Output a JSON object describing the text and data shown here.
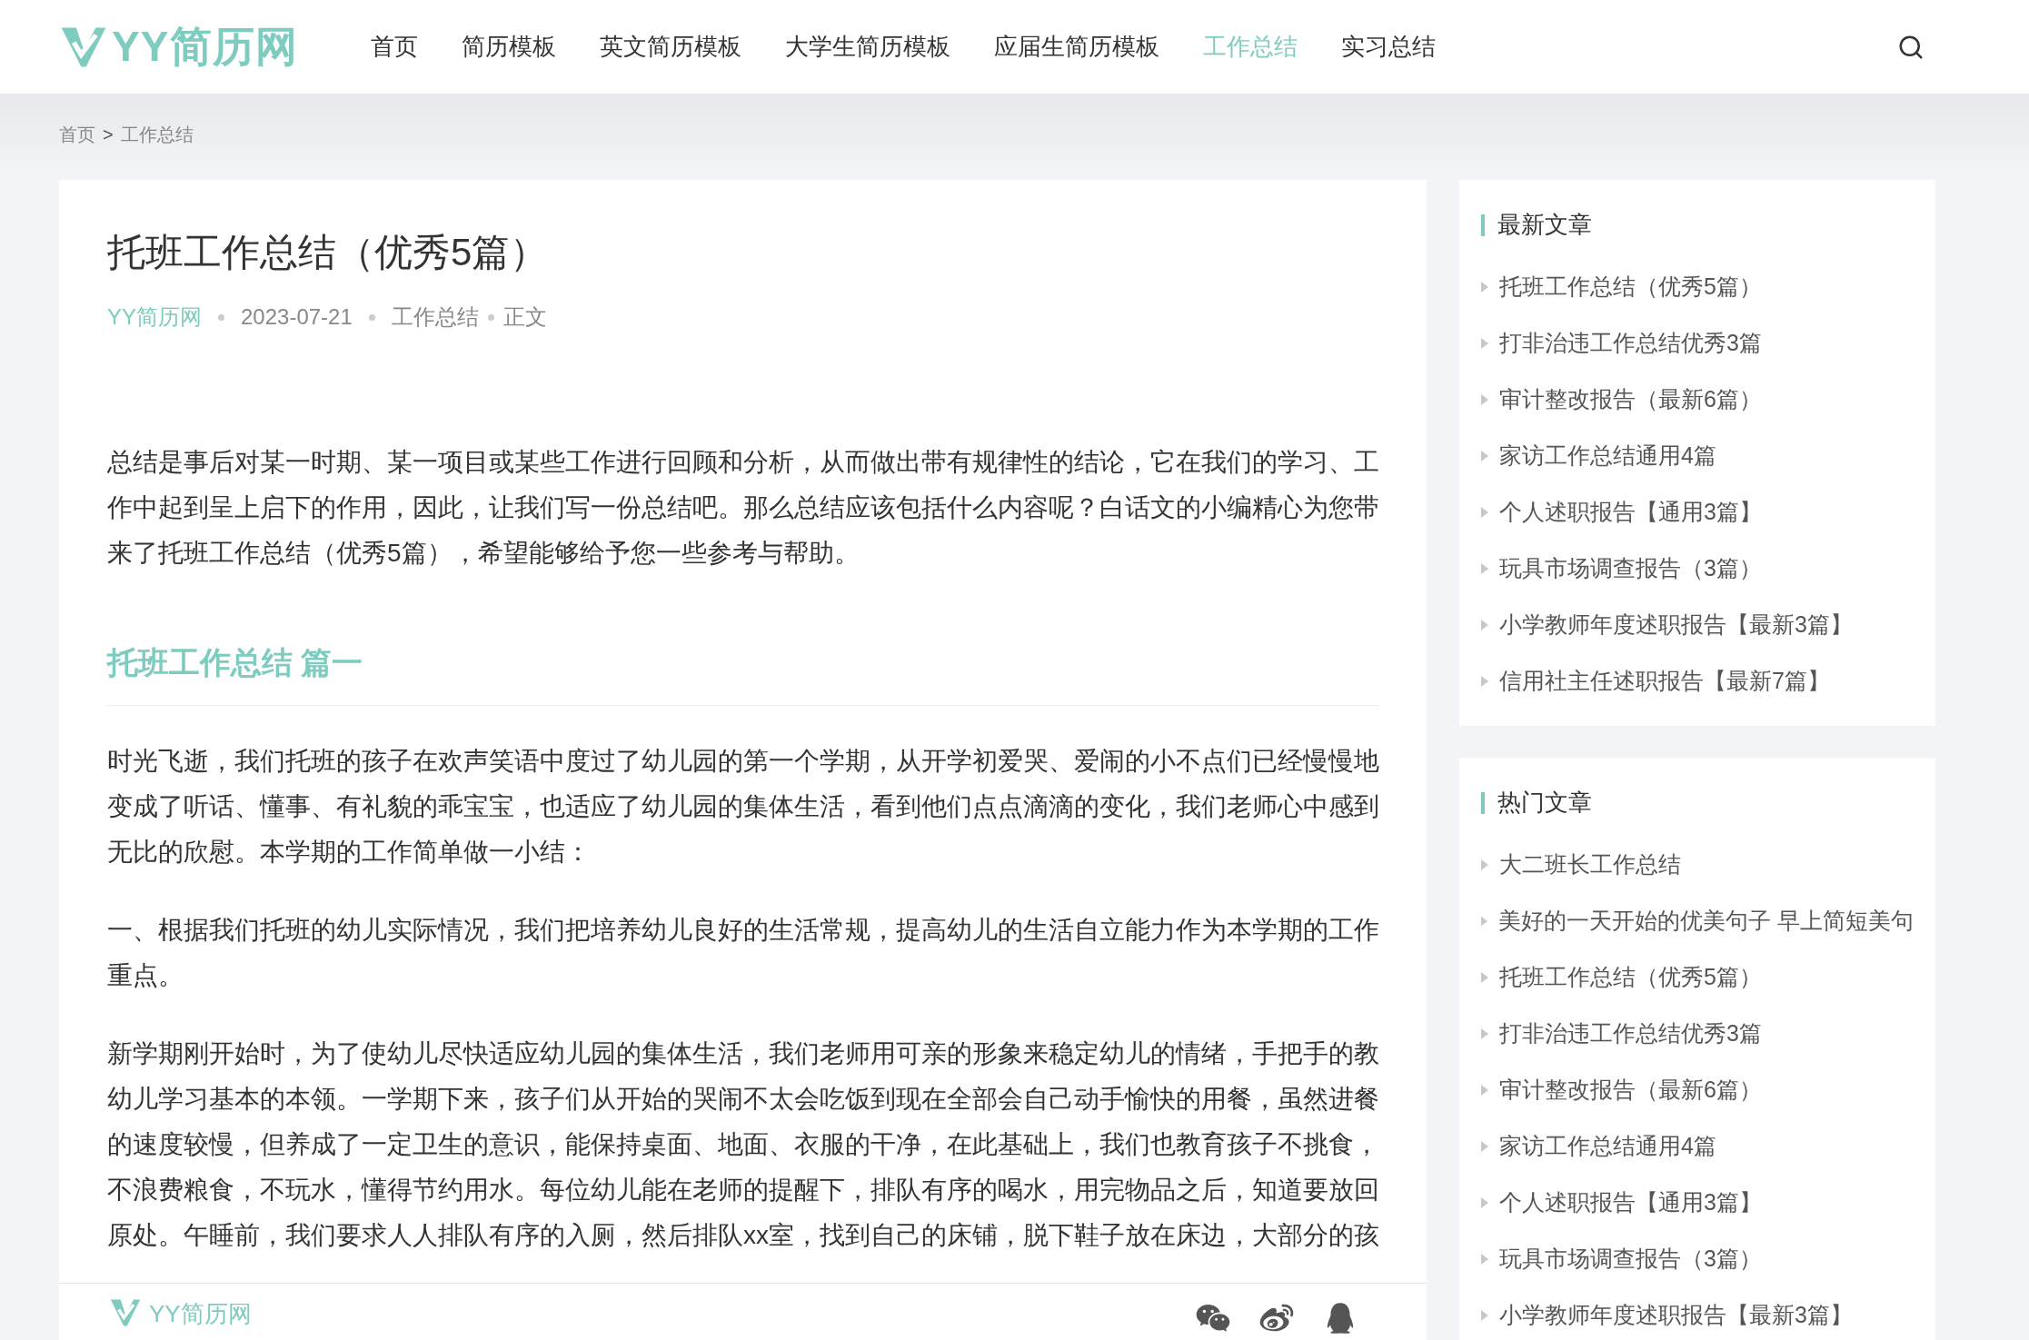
{
  "header": {
    "logo": "YY简历网",
    "nav": [
      {
        "label": "首页",
        "selected": false
      },
      {
        "label": "简历模板",
        "selected": false
      },
      {
        "label": "英文简历模板",
        "selected": false
      },
      {
        "label": "大学生简历模板",
        "selected": false
      },
      {
        "label": "应届生简历模板",
        "selected": false
      },
      {
        "label": "工作总结",
        "selected": true
      },
      {
        "label": "实习总结",
        "selected": false
      }
    ]
  },
  "breadcrumb": [
    "首页",
    ">",
    "工作总结"
  ],
  "article": {
    "title": "托班工作总结（优秀5篇）",
    "meta": {
      "site": "YY简历网",
      "date": "2023-07-21",
      "category": "工作总结",
      "section": "正文"
    },
    "blocks": [
      {
        "kind": "paragraph",
        "text": "总结是事后对某一时期、某一项目或某些工作进行回顾和分析，从而做出带有规律性的结论，它在我们的学习、工作中起到呈上启下的作用，因此，让我们写一份总结吧。那么总结应该包括什么内容呢？白话文的小编精心为您带来了托班工作总结（优秀5篇），希望能够给予您一些参考与帮助。"
      },
      {
        "kind": "heading",
        "text": "托班工作总结 篇一"
      },
      {
        "kind": "paragraph",
        "text": "时光飞逝，我们托班的孩子在欢声笑语中度过了幼儿园的第一个学期，从开学初爱哭、爱闹的小不点们已经慢慢地变成了听话、懂事、有礼貌的乖宝宝，也适应了幼儿园的集体生活，看到他们点点滴滴的变化，我们老师心中感到无比的欣慰。本学期的工作简单做一小结："
      },
      {
        "kind": "paragraph",
        "text": "一、根据我们托班的幼儿实际情况，我们把培养幼儿良好的生活常规，提高幼儿的生活自立能力作为本学期的工作重点。"
      },
      {
        "kind": "paragraph",
        "text": "新学期刚开始时，为了使幼儿尽快适应幼儿园的集体生活，我们老师用可亲的形象来稳定幼儿的情绪，手把手的教幼儿学习基本的本领。一学期下来，孩子们从开始的哭闹不太会吃饭到现在全部会自己动手愉快的用餐，虽然进餐的速度较慢，但养成了一定卫生的意识，能保持桌面、地面、衣服的干净，在此基础上，我们也教育孩子不挑食，不浪费粮食，不玩水，懂得节约用水。每位幼儿能在老师的提醒下，排队有序的喝水，用完物品之后，知道要放回原处。午睡前，我们要求人人排队有序的入厕，然后排队xx室，找到自己的床铺，脱下鞋子放在床边，大部分的孩"
      }
    ]
  },
  "sidebar": [
    {
      "title": "最新文章",
      "items": [
        "托班工作总结（优秀5篇）",
        "打非治违工作总结优秀3篇",
        "审计整改报告（最新6篇）",
        "家访工作总结通用4篇",
        "个人述职报告【通用3篇】",
        "玩具市场调查报告（3篇）",
        "小学教师年度述职报告【最新3篇】",
        "信用社主任述职报告【最新7篇】"
      ]
    },
    {
      "title": "热门文章",
      "items": [
        "大二班长工作总结",
        "美好的一天开始的优美句子 早上简短美句",
        "托班工作总结（优秀5篇）",
        "打非治违工作总结优秀3篇",
        "审计整改报告（最新6篇）",
        "家访工作总结通用4篇",
        "个人述职报告【通用3篇】",
        "玩具市场调查报告（3篇）",
        "小学教师年度述职报告【最新3篇】"
      ]
    }
  ],
  "share_bar": {
    "logo": "YY简历网"
  }
}
